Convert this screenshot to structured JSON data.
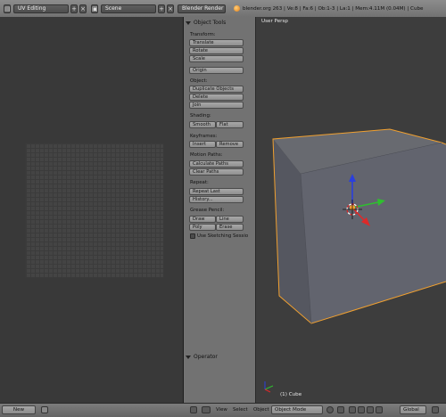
{
  "header": {
    "layout": "UV Editing",
    "scene": "Scene",
    "renderer": "Blender Render",
    "info": "blender.org 263 | Ve:8 | Fa:6 | Ob:1-3 | La:1 | Mem:4.11M (0.04M) | Cube"
  },
  "tool_shelf": {
    "title": "Object Tools",
    "transform": {
      "label": "Transform:",
      "translate": "Translate",
      "rotate": "Rotate",
      "scale": "Scale"
    },
    "origin": "Origin",
    "object": {
      "label": "Object:",
      "duplicate": "Duplicate Objects",
      "delete": "Delete",
      "join": "Join"
    },
    "shading": {
      "label": "Shading:",
      "smooth": "Smooth",
      "flat": "Flat"
    },
    "keyframes": {
      "label": "Keyframes:",
      "insert": "Insert",
      "remove": "Remove"
    },
    "motion_paths": {
      "label": "Motion Paths:",
      "calculate": "Calculate Paths",
      "clear": "Clear Paths"
    },
    "repeat": {
      "label": "Repeat:",
      "repeat_last": "Repeat Last",
      "history": "History..."
    },
    "grease_pencil": {
      "label": "Grease Pencil:",
      "draw": "Draw",
      "line": "Line",
      "poly": "Poly",
      "erase": "Erase",
      "use_sketching": "Use Sketching Sessio"
    },
    "operator_title": "Operator"
  },
  "viewport": {
    "view_name": "User Persp",
    "object_name": "(1) Cube"
  },
  "footer": {
    "new_button": "New",
    "menus": [
      "View",
      "Select",
      "Object"
    ],
    "mode": "Object Mode",
    "orientation": "Global"
  },
  "colors": {
    "selection_outline": "#f0a030",
    "axis_x": "#dd2a2a",
    "axis_y": "#2fbf2f",
    "axis_z": "#2a3fdd"
  }
}
